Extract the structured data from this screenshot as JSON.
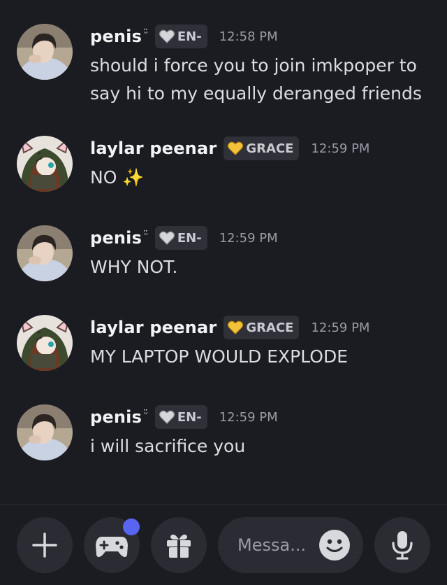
{
  "messages": [
    {
      "author": "penis",
      "suffix": "ᵕ̈",
      "tag": "EN-",
      "tag_icon": "white-heart-icon",
      "time": "12:58 PM",
      "lines": [
        "should i force you to join imkpoper to",
        "say hi to my equally deranged friends"
      ]
    },
    {
      "author": "laylar peenar",
      "tag": "GRACE",
      "tag_icon": "yellow-heart-icon",
      "time": "12:59 PM",
      "lines": [
        "NO ✨"
      ]
    },
    {
      "author": "penis",
      "suffix": "ᵕ̈",
      "tag": "EN-",
      "tag_icon": "white-heart-icon",
      "time": "12:59 PM",
      "lines": [
        "WHY NOT."
      ]
    },
    {
      "author": "laylar peenar",
      "tag": "GRACE",
      "tag_icon": "yellow-heart-icon",
      "time": "12:59 PM",
      "lines": [
        "MY LAPTOP WOULD EXPLODE"
      ]
    },
    {
      "author": "penis",
      "suffix": "ᵕ̈",
      "tag": "EN-",
      "tag_icon": "white-heart-icon",
      "time": "12:59 PM",
      "lines": [
        "i will sacrifice you"
      ]
    }
  ],
  "composer": {
    "placeholder": "Messa...",
    "buttons": [
      "plus-icon",
      "gamepad-icon",
      "gift-icon",
      "microphone-icon",
      "smiley-icon"
    ]
  },
  "colors": {
    "background": "#1b1c22",
    "button": "#2b2c33",
    "badge": "#5865f2",
    "tag_bg": "#2f3038",
    "timestamp": "#9a9ca4"
  }
}
